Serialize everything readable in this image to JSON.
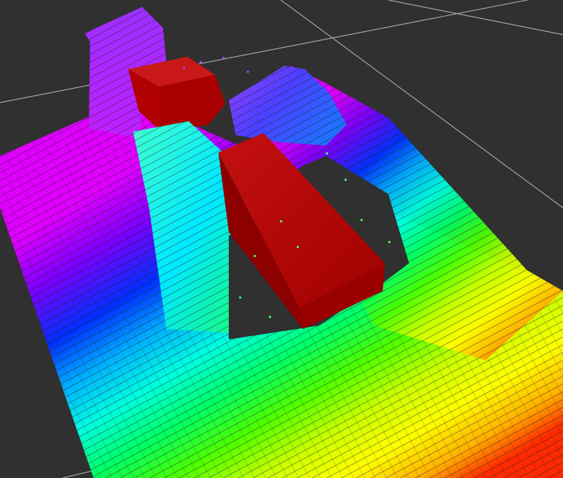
{
  "viewport": {
    "background_color": "#303030",
    "grid_line_color": "#a8a8a8"
  },
  "scene": {
    "floor_colormap": [
      "#ff2a00",
      "#ffb000",
      "#ffff00",
      "#c8ff00",
      "#4cff00",
      "#00ff66",
      "#00ffe0",
      "#00b0ff",
      "#0030ff",
      "#7a00ff",
      "#e000ff"
    ],
    "obstacle_color": "#c00000",
    "obstacles": [
      {
        "name": "large-red-box"
      },
      {
        "name": "small-red-box"
      }
    ],
    "wall_point_clouds": [
      {
        "name": "back-left-wall-cloud",
        "color": "#8a2cff"
      },
      {
        "name": "center-wall-cloud",
        "color": "#22ffb0"
      },
      {
        "name": "right-back-wall-cloud",
        "color": "#6a3cff"
      }
    ]
  }
}
